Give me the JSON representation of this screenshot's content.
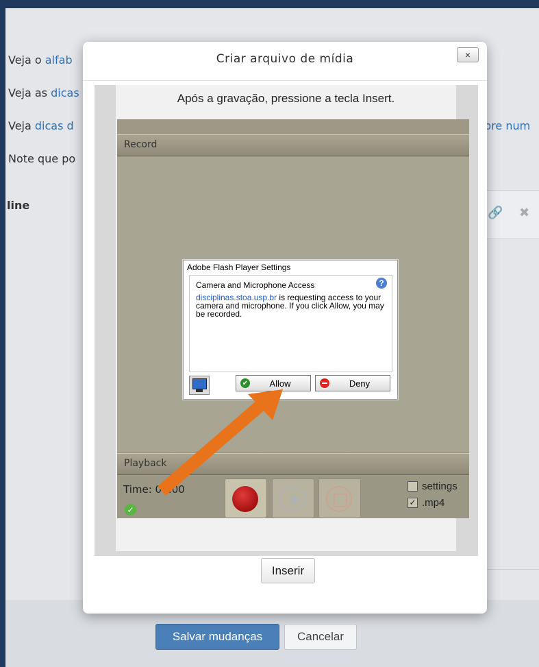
{
  "background": {
    "lines": [
      {
        "prefix": "Veja o ",
        "link": "alfab"
      },
      {
        "prefix": "Veja as ",
        "link": "dicas"
      },
      {
        "prefix": "Veja ",
        "link": "dicas d"
      },
      {
        "text": "Note que po"
      }
    ],
    "heading": "line",
    "right_text": "bre num",
    "buttons": {
      "save": "Salvar mudanças",
      "cancel": "Cancelar"
    }
  },
  "modal": {
    "title": "Criar arquivo de mídia",
    "close_label": "×",
    "insert_hint": "Após a gravação, pressione a tecla Insert.",
    "record_label": "Record",
    "playback_label": "Playback",
    "time_label": "Time:",
    "time_value": "00:00",
    "settings_label": "settings",
    "mp4_label": ".mp4",
    "mp4_checked": true,
    "settings_checked": false,
    "insert_button": "Inserir"
  },
  "adobe_dialog": {
    "title": "Adobe Flash Player Settings",
    "heading": "Camera and Microphone Access",
    "domain": "disciplinas.stoa.usp.br",
    "message": " is requesting access to your camera and microphone. If you click Allow, you may be recorded.",
    "help": "?",
    "allow": "Allow",
    "deny": "Deny"
  },
  "colors": {
    "accent": "#4a7fb8",
    "arrow": "#e8731a",
    "flash_bg": "#a8a593"
  }
}
